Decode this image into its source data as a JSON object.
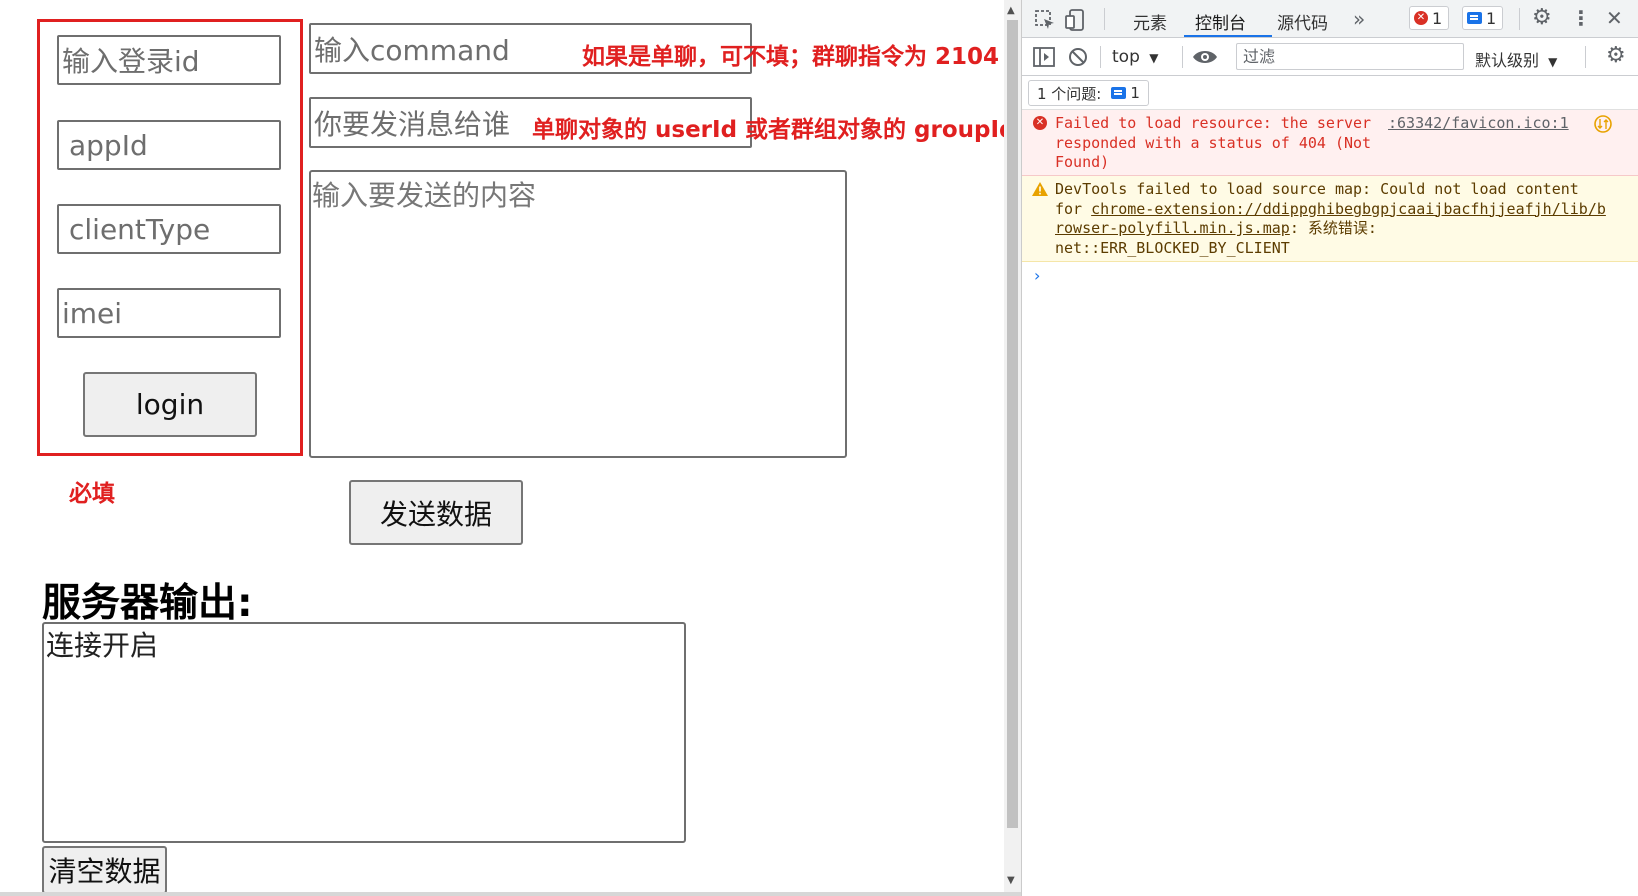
{
  "page": {
    "login": {
      "login_id_placeholder": "输入登录id",
      "appid_placeholder": "appId",
      "client_type_placeholder": "clientType",
      "imei_placeholder": "imei",
      "login_button": "login",
      "required_note": "必填"
    },
    "command": {
      "placeholder": "输入command",
      "note": "如果是单聊，可不填；群聊指令为 2104"
    },
    "target": {
      "placeholder": "你要发消息给谁",
      "note": "单聊对象的 userId 或者群组对象的 groupId"
    },
    "content_placeholder": "输入要发送的内容",
    "send_button": "发送数据",
    "server_output_title": "服务器输出:",
    "server_output_text": "连接开启",
    "clear_button": "清空数据"
  },
  "devtools": {
    "tabs": [
      "元素",
      "控制台",
      "源代码"
    ],
    "active_tab": "控制台",
    "more_tabs": "»",
    "error_count": "1",
    "message_count": "1",
    "context": "top",
    "filter_placeholder": "过滤",
    "levels": "默认级别",
    "issues_label": "1 个问题:",
    "issues_count": "1",
    "messages": {
      "error_text": "Failed to load resource: the server\nresponded with a status of 404 (Not\nFound)",
      "error_source": ":63342/favicon.ico:1",
      "warn_line1": "DevTools failed to load source map: Could not load content",
      "warn_for": "for ",
      "warn_link1": "chrome-extension://ddippghibegbgpjcaaijbacfhjjeafjh/lib/b",
      "warn_link2": "rowser-polyfill.min.js.map",
      "warn_suffix": ": 系统错误:",
      "warn_line4": "net::ERR_BLOCKED_BY_CLIENT"
    },
    "colors": {
      "accent": "#1a73e8",
      "error": "#d93025",
      "annotation": "#e02020"
    }
  }
}
